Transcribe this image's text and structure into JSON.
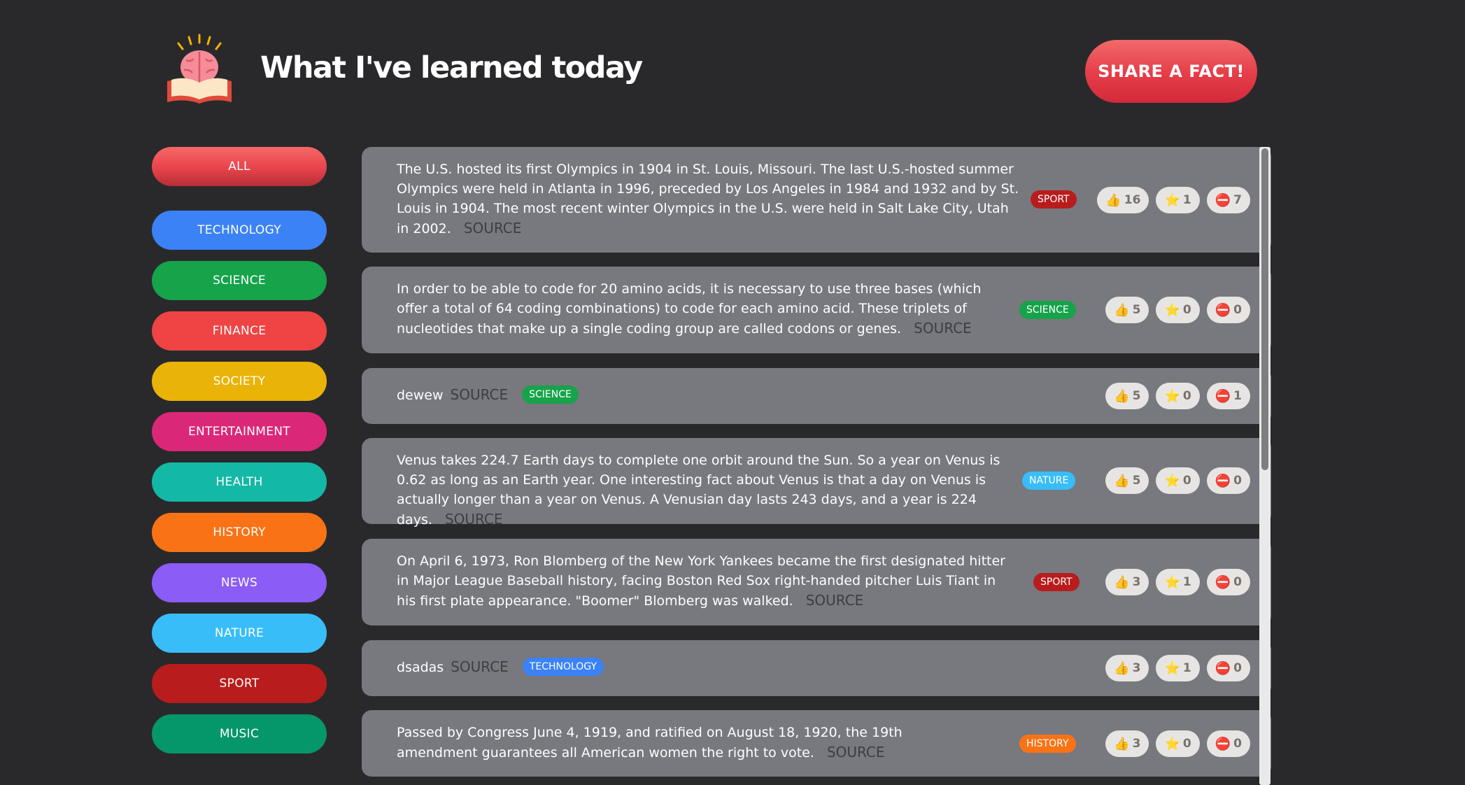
{
  "header": {
    "title": "What I've learned today",
    "share_button": "SHARE A FACT!",
    "logo_icon": "brain-book-icon"
  },
  "categories": [
    {
      "label": "ALL",
      "color": "#e8434c"
    },
    {
      "label": "TECHNOLOGY",
      "color": "#3b82f6"
    },
    {
      "label": "SCIENCE",
      "color": "#16a34a"
    },
    {
      "label": "FINANCE",
      "color": "#ef4444"
    },
    {
      "label": "SOCIETY",
      "color": "#eab308"
    },
    {
      "label": "ENTERTAINMENT",
      "color": "#db2777"
    },
    {
      "label": "HEALTH",
      "color": "#14b8a6"
    },
    {
      "label": "HISTORY",
      "color": "#f97316"
    },
    {
      "label": "NEWS",
      "color": "#8b5cf6"
    },
    {
      "label": "NATURE",
      "color": "#38bdf8"
    },
    {
      "label": "SPORT",
      "color": "#b91c1c"
    },
    {
      "label": "MUSIC",
      "color": "#059669"
    }
  ],
  "facts": [
    {
      "text": "The U.S. hosted its first Olympics in 1904 in St. Louis, Missouri. The last U.S.-hosted summer Olympics were held in Atlanta in 1996, preceded by Los Angeles in 1984 and 1932 and by St. Louis in 1904. The most recent winter Olympics in the U.S. were held in Salt Lake City, Utah in 2002.",
      "source": "SOURCE",
      "tag": "SPORT",
      "tag_color": "#b91c1c",
      "likes": "16",
      "stars": "1",
      "dislikes": "7"
    },
    {
      "text": "In order to be able to code for 20 amino acids, it is necessary to use three bases (which offer a total of 64 coding combinations) to code for each amino acid. These triplets of nucleotides that make up a single coding group are called codons or genes.",
      "source": "SOURCE",
      "tag": "SCIENCE",
      "tag_color": "#16a34a",
      "likes": "5",
      "stars": "0",
      "dislikes": "0"
    },
    {
      "text": "dewew",
      "source": "SOURCE",
      "tag": "SCIENCE",
      "tag_color": "#16a34a",
      "likes": "5",
      "stars": "0",
      "dislikes": "1"
    },
    {
      "text": "Venus takes 224.7 Earth days to complete one orbit around the Sun. So a year on Venus is 0.62 as long as an Earth year. One interesting fact about Venus is that a day on Venus is actually longer than a year on Venus. A Venusian day lasts 243 days, and a year is 224 days.",
      "source": "SOURCE",
      "tag": "NATURE",
      "tag_color": "#38bdf8",
      "likes": "5",
      "stars": "0",
      "dislikes": "0"
    },
    {
      "text": "On April 6, 1973, Ron Blomberg of the New York Yankees became the first designated hitter in Major League Baseball history, facing Boston Red Sox right-handed pitcher Luis Tiant in his first plate appearance. \"Boomer\" Blomberg was walked.",
      "source": "SOURCE",
      "tag": "SPORT",
      "tag_color": "#b91c1c",
      "likes": "3",
      "stars": "1",
      "dislikes": "0"
    },
    {
      "text": "dsadas",
      "source": "SOURCE",
      "tag": "TECHNOLOGY",
      "tag_color": "#3b82f6",
      "likes": "3",
      "stars": "1",
      "dislikes": "0"
    },
    {
      "text": "Passed by Congress June 4, 1919, and ratified on August 18, 1920, the 19th amendment guarantees all American women the right to vote.",
      "source": "SOURCE",
      "tag": "HISTORY",
      "tag_color": "#f97316",
      "likes": "3",
      "stars": "0",
      "dislikes": "0"
    }
  ],
  "vote_icons": {
    "like": "👍",
    "star": "⭐",
    "dislike": "⛔"
  }
}
